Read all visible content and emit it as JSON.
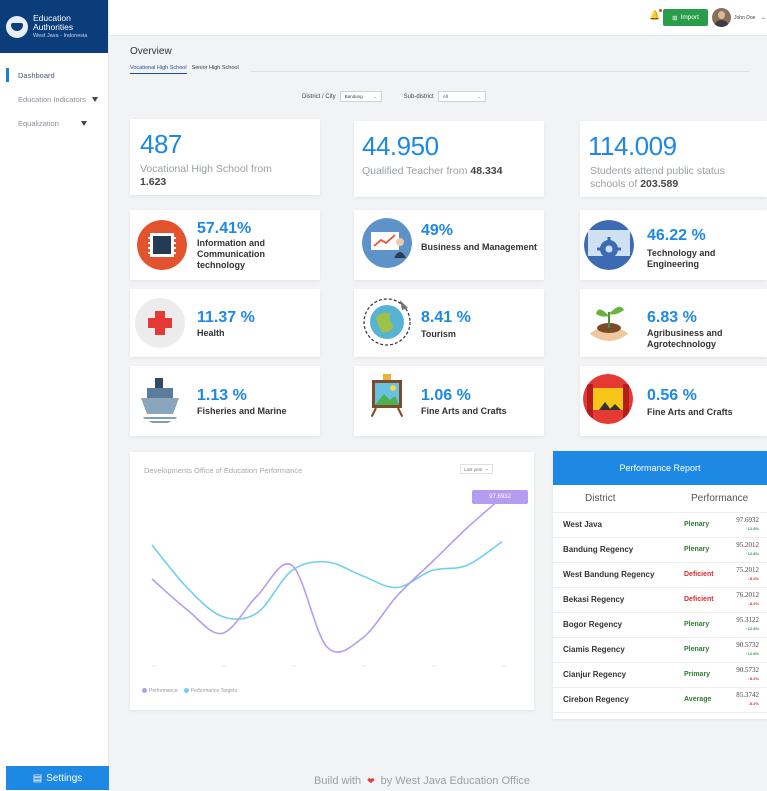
{
  "brand": {
    "title": "Education Authorities",
    "subtitle": "West Java - Indonesia"
  },
  "sidebar": {
    "items": [
      {
        "label": "Dashboard"
      },
      {
        "label": "Education Indicators"
      },
      {
        "label": "Equalization"
      }
    ],
    "settings_label": "Settings"
  },
  "topbar": {
    "import_label": "Import",
    "user_name": "John Doe"
  },
  "overview": {
    "title": "Overview",
    "tabs": [
      "Vocational High School",
      "Senior High School"
    ],
    "filters": {
      "district_label": "District / City",
      "district_value": "Bandung",
      "subdistrict_label": "Sub-district",
      "subdistrict_value": "All"
    }
  },
  "stats": [
    {
      "value": "487",
      "text": "Vocational High School from",
      "bold": "1.623"
    },
    {
      "value": "44.950",
      "text": "Qualified Teacher from",
      "bold": "48.334"
    },
    {
      "value": "114.009",
      "text": "Students attend public status schools of",
      "bold": "203.589"
    }
  ],
  "categories": [
    {
      "pct": "57.41%",
      "label": "Information and Communication technology",
      "icon": "chip-icon"
    },
    {
      "pct": "49%",
      "label": "Business and Management",
      "icon": "presentation-icon"
    },
    {
      "pct": "46.22 %",
      "label": "Technology and Engineering",
      "icon": "gear-icon"
    },
    {
      "pct": "11.37 %",
      "label": "Health",
      "icon": "medical-cross-icon"
    },
    {
      "pct": "8.41 %",
      "label": "Tourism",
      "icon": "globe-icon"
    },
    {
      "pct": "6.83 %",
      "label": "Agribusiness and Agrotechnology",
      "icon": "seedling-icon"
    },
    {
      "pct": "1.13 %",
      "label": "Fisheries and Marine",
      "icon": "ship-icon"
    },
    {
      "pct": "1.06 %",
      "label": "Fine Arts and Crafts",
      "icon": "easel-icon"
    },
    {
      "pct": "0.56 %",
      "label": "Fine Arts and Crafts",
      "icon": "puppet-stage-icon"
    }
  ],
  "chart": {
    "title": "Developments Office of Education Performance",
    "range_label": "Last year",
    "tooltip_value": "97.6932",
    "legend": [
      "Performance",
      "Performance Targets"
    ],
    "colors": {
      "performance": "#b69cf0",
      "targets": "#6fd0ef"
    }
  },
  "chart_data": {
    "type": "line",
    "x": [
      0,
      1,
      2,
      3,
      4,
      5
    ],
    "ylim": [
      0,
      100
    ],
    "series": [
      {
        "name": "Performance",
        "values": [
          50,
          32,
          18,
          40,
          58,
          10,
          15,
          40,
          60,
          80,
          98
        ]
      },
      {
        "name": "Performance Targets",
        "values": [
          70,
          45,
          28,
          30,
          55,
          60,
          52,
          45,
          55,
          58,
          72
        ]
      }
    ]
  },
  "report": {
    "title": "Performance Report",
    "col_district": "District",
    "col_performance": "Performance",
    "rows": [
      {
        "district": "West Java",
        "status": "Plenary",
        "value": "97.6932",
        "trend": "12.8%",
        "dir": "up"
      },
      {
        "district": "Bandung Regency",
        "status": "Plenary",
        "value": "95.2012",
        "trend": "12.8%",
        "dir": "up"
      },
      {
        "district": "West Bandung Regency",
        "status": "Deficient",
        "value": "75.2012",
        "trend": "8.2%",
        "dir": "down"
      },
      {
        "district": "Bekasi Regency",
        "status": "Deficient",
        "value": "76.2012",
        "trend": "8.2%",
        "dir": "down"
      },
      {
        "district": "Bogor Regency",
        "status": "Plenary",
        "value": "95.3122",
        "trend": "12.8%",
        "dir": "up"
      },
      {
        "district": "Ciamis Regency",
        "status": "Plenary",
        "value": "90.5732",
        "trend": "12.8%",
        "dir": "up"
      },
      {
        "district": "Cianjur Regency",
        "status": "Primary",
        "value": "90.5732",
        "trend": "8.2%",
        "dir": "down"
      },
      {
        "district": "Cirebon Regency",
        "status": "Average",
        "value": "85.3742",
        "trend": "8.2%",
        "dir": "down"
      }
    ]
  },
  "footer": {
    "prefix": "Build with",
    "suffix": "by West Java Education Office"
  }
}
